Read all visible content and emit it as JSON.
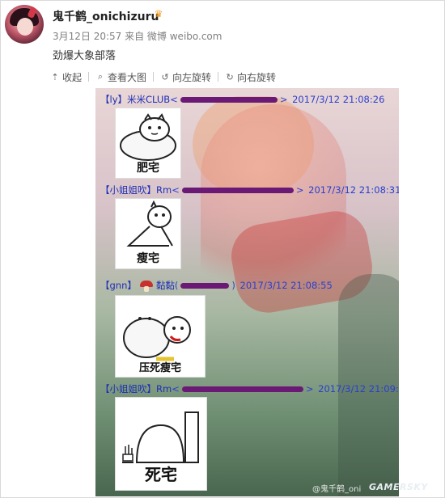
{
  "post": {
    "username": "鬼千鹤_onichizuru",
    "meta": "3月12日 20:57 来自 微博 weibo.com",
    "text": "劲爆大象部落"
  },
  "toolbar": {
    "collapse": "收起",
    "view_large": "查看大图",
    "rotate_left": "向左旋转",
    "rotate_right": "向右旋转"
  },
  "chat": [
    {
      "nick": "【ly】米米CLUB",
      "prefix": "<",
      "suffix": ">",
      "time": "2017/3/12 21:08:26",
      "sticker": "肥宅"
    },
    {
      "nick": "【小姐姐吹】Rm",
      "prefix": "<",
      "suffix": ">",
      "time": "2017/3/12 21:08:31",
      "sticker": "瘦宅"
    },
    {
      "nick": "【gnn】",
      "nick2": "黏黏",
      "prefix": "(",
      "suffix": ")",
      "time": "2017/3/12 21:08:55",
      "sticker": "压死瘦宅"
    },
    {
      "nick": "【小姐姐吹】Rm",
      "prefix": "<",
      "suffix": ">",
      "time": "2017/3/12 21:09:32",
      "sticker": "死宅"
    }
  ],
  "watermark": "@鬼千鹤_oni",
  "logo": "GAMERSKY",
  "icons": {
    "collapse": "collapse-icon",
    "view_large": "magnifier-icon",
    "rotate_left": "rotate-left-icon",
    "rotate_right": "rotate-right-icon"
  }
}
